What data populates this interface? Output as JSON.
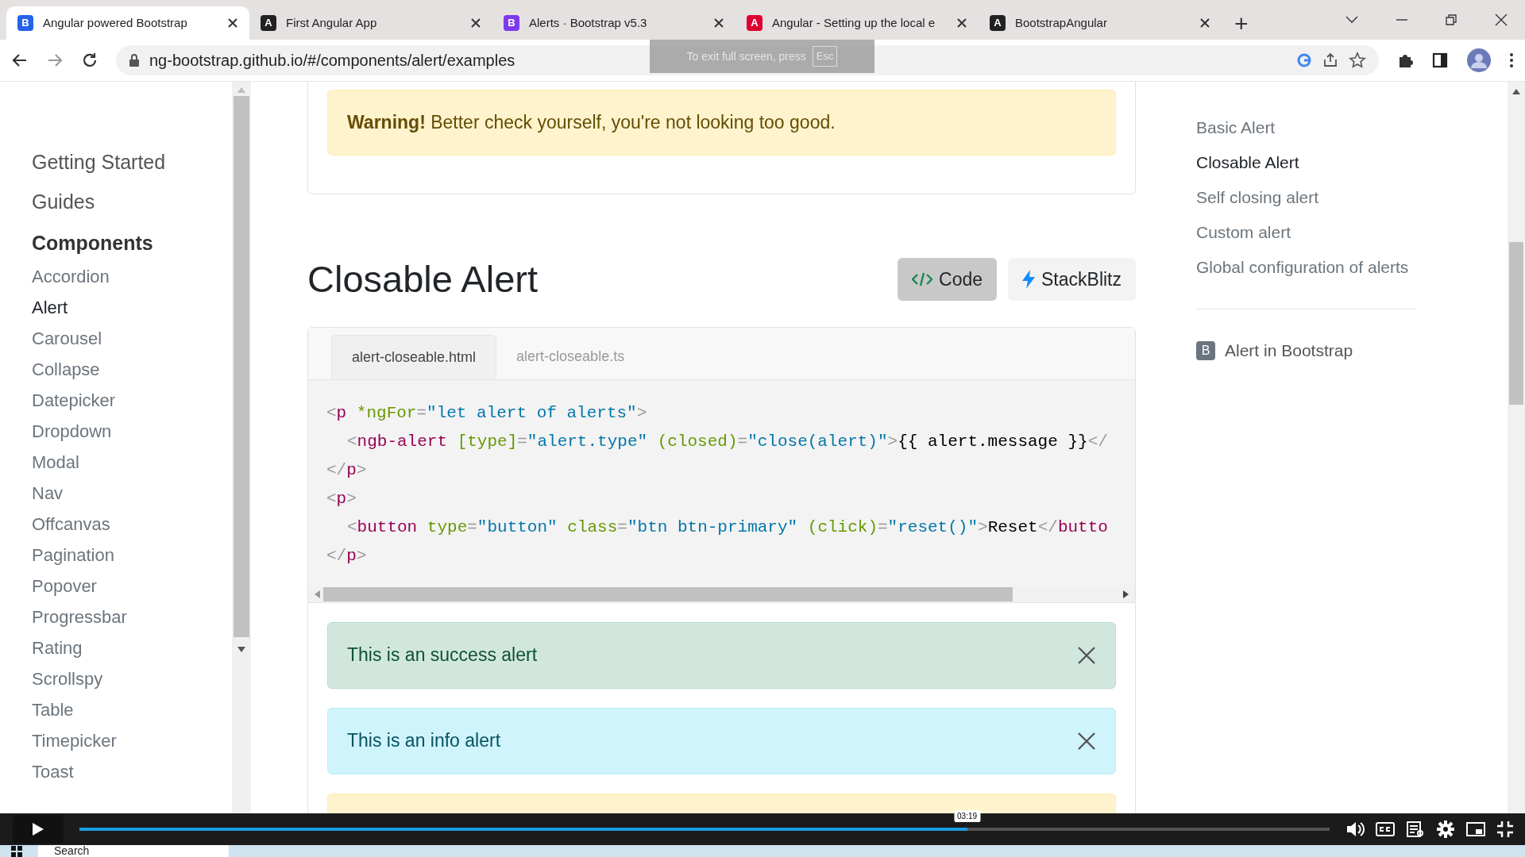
{
  "browser": {
    "tabs": [
      {
        "title": "Angular powered Bootstrap",
        "icon": "B",
        "color": "#2563eb",
        "selected": true
      },
      {
        "title": "First Angular App",
        "icon": "A",
        "color": "#222222",
        "selected": false
      },
      {
        "title": "Alerts · Bootstrap v5.3",
        "icon": "B",
        "color": "#7c3aed",
        "selected": false
      },
      {
        "title": "Angular - Setting up the local e",
        "icon": "A",
        "color": "#dd0031",
        "selected": false
      },
      {
        "title": "BootstrapAngular",
        "icon": "A",
        "color": "#222222",
        "selected": false
      }
    ],
    "new_tab": "+",
    "address": "ng-bootstrap.github.io/#/components/alert/examples",
    "fullscreen_notice": {
      "text": "To exit full screen, press",
      "key": "Esc"
    }
  },
  "sidebar": {
    "sections": [
      {
        "label": "Getting Started"
      },
      {
        "label": "Guides"
      }
    ],
    "heading": "Components",
    "items": [
      {
        "label": "Accordion",
        "selected": false
      },
      {
        "label": "Alert",
        "selected": true
      },
      {
        "label": "Carousel",
        "selected": false
      },
      {
        "label": "Collapse",
        "selected": false
      },
      {
        "label": "Datepicker",
        "selected": false
      },
      {
        "label": "Dropdown",
        "selected": false
      },
      {
        "label": "Modal",
        "selected": false
      },
      {
        "label": "Nav",
        "selected": false
      },
      {
        "label": "Offcanvas",
        "selected": false
      },
      {
        "label": "Pagination",
        "selected": false
      },
      {
        "label": "Popover",
        "selected": false
      },
      {
        "label": "Progressbar",
        "selected": false
      },
      {
        "label": "Rating",
        "selected": false
      },
      {
        "label": "Scrollspy",
        "selected": false
      },
      {
        "label": "Table",
        "selected": false
      },
      {
        "label": "Timepicker",
        "selected": false
      },
      {
        "label": "Toast",
        "selected": false
      }
    ]
  },
  "top_alert": {
    "text": "**Warning!** Better check yourself, you're not looking too good."
  },
  "section": {
    "title": "Closable Alert",
    "buttons": [
      {
        "kind": "code",
        "label": "Code"
      },
      {
        "kind": "stackblitz",
        "label": "StackBlitz"
      }
    ],
    "code_tabs": [
      {
        "label": "alert-closeable.html",
        "selected": true
      },
      {
        "label": "alert-closeable.ts",
        "selected": false
      }
    ],
    "code_lines": [
      {
        "indented": false,
        "tokens": [
          {
            "kind": "punct",
            "text": "<"
          },
          {
            "kind": "tag",
            "text": "p"
          },
          {
            "kind": "attr",
            "text": " *ngFor"
          },
          {
            "kind": "punct",
            "text": "="
          },
          {
            "kind": "string",
            "text": "\"let alert of alerts\""
          },
          {
            "kind": "punct",
            "text": ">"
          }
        ]
      },
      {
        "indented": true,
        "tokens": [
          {
            "kind": "punct",
            "text": "<"
          },
          {
            "kind": "tag",
            "text": "ngb-alert"
          },
          {
            "kind": "attr",
            "text": " [type]"
          },
          {
            "kind": "punct",
            "text": "="
          },
          {
            "kind": "string",
            "text": "\"alert.type\""
          },
          {
            "kind": "attr",
            "text": " (closed)"
          },
          {
            "kind": "punct",
            "text": "="
          },
          {
            "kind": "string",
            "text": "\"close(alert)\""
          },
          {
            "kind": "punct",
            "text": ">"
          },
          {
            "kind": "text",
            "text": "{{ alert.message }}"
          },
          {
            "kind": "punct",
            "text": "</"
          }
        ]
      },
      {
        "indented": false,
        "tokens": [
          {
            "kind": "punct",
            "text": "</"
          },
          {
            "kind": "tag",
            "text": "p"
          },
          {
            "kind": "punct",
            "text": ">"
          }
        ]
      },
      {
        "indented": false,
        "tokens": [
          {
            "kind": "punct",
            "text": "<"
          },
          {
            "kind": "tag",
            "text": "p"
          },
          {
            "kind": "punct",
            "text": ">"
          }
        ]
      },
      {
        "indented": true,
        "tokens": [
          {
            "kind": "punct",
            "text": "<"
          },
          {
            "kind": "tag",
            "text": "button"
          },
          {
            "kind": "attr",
            "text": " type"
          },
          {
            "kind": "punct",
            "text": "="
          },
          {
            "kind": "string",
            "text": "\"button\""
          },
          {
            "kind": "attr",
            "text": " class"
          },
          {
            "kind": "punct",
            "text": "="
          },
          {
            "kind": "string",
            "text": "\"btn btn-primary\""
          },
          {
            "kind": "attr",
            "text": " (click)"
          },
          {
            "kind": "punct",
            "text": "="
          },
          {
            "kind": "string",
            "text": "\"reset()\""
          },
          {
            "kind": "punct",
            "text": ">"
          },
          {
            "kind": "text",
            "text": "Reset"
          },
          {
            "kind": "punct",
            "text": "</"
          },
          {
            "kind": "tag",
            "text": "butto"
          }
        ]
      },
      {
        "indented": false,
        "tokens": [
          {
            "kind": "punct",
            "text": "</"
          },
          {
            "kind": "tag",
            "text": "p"
          },
          {
            "kind": "punct",
            "text": ">"
          }
        ]
      }
    ],
    "alerts": [
      {
        "kind": "success",
        "text": "This is an success alert"
      },
      {
        "kind": "info",
        "text": "This is an info alert"
      },
      {
        "kind": "warning"
      }
    ]
  },
  "toc": {
    "items": [
      {
        "label": "Basic Alert",
        "selected": false
      },
      {
        "label": "Closable Alert",
        "selected": true
      },
      {
        "label": "Self closing alert",
        "selected": false
      },
      {
        "label": "Custom alert",
        "selected": false
      },
      {
        "label": "Global configuration of alerts",
        "selected": false
      }
    ],
    "link": {
      "icon": "B",
      "label": "Alert in Bootstrap"
    }
  },
  "video": {
    "level": 0.71,
    "time": "03:19"
  },
  "taskbar": {
    "search": "Search"
  }
}
